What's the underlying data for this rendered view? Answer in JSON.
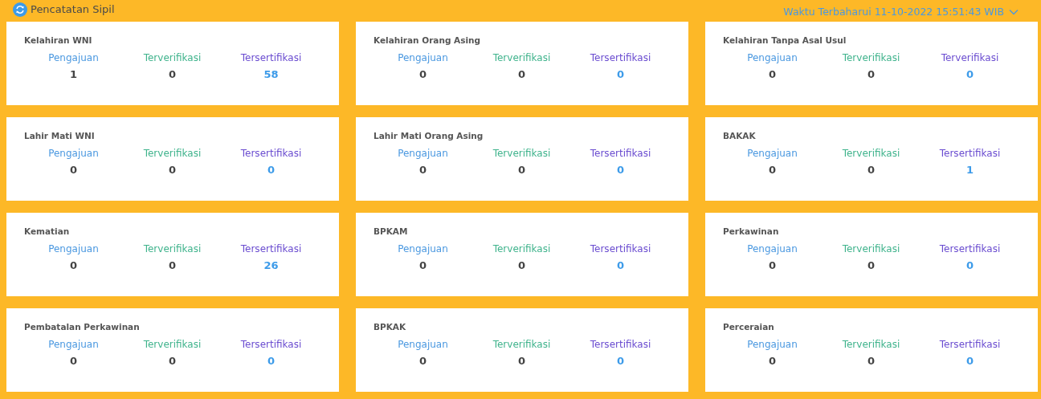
{
  "header": {
    "title": "Pencatatan Sipil",
    "updated": "Waktu Terbaharui 11-10-2022 15:51:43 WIB"
  },
  "cards": [
    {
      "title": "Kelahiran WNI",
      "stats": [
        {
          "kind": "submitted",
          "label": "Pengajuan",
          "value": "1"
        },
        {
          "kind": "verified",
          "label": "Terverifikasi",
          "value": "0"
        },
        {
          "kind": "certified",
          "label": "Tersertifikasi",
          "value": "58"
        }
      ]
    },
    {
      "title": "Kelahiran Orang Asing",
      "stats": [
        {
          "kind": "submitted",
          "label": "Pengajuan",
          "value": "0"
        },
        {
          "kind": "verified",
          "label": "Terverifikasi",
          "value": "0"
        },
        {
          "kind": "certified",
          "label": "Tersertifikasi",
          "value": "0"
        }
      ]
    },
    {
      "title": "Kelahiran Tanpa Asal Usul",
      "stats": [
        {
          "kind": "submitted",
          "label": "Pengajuan",
          "value": "0"
        },
        {
          "kind": "verified",
          "label": "Terverifikasi",
          "value": "0"
        },
        {
          "kind": "certified",
          "label": "Terverifikasi",
          "value": "0"
        }
      ]
    },
    {
      "title": "Lahir Mati WNI",
      "stats": [
        {
          "kind": "submitted",
          "label": "Pengajuan",
          "value": "0"
        },
        {
          "kind": "verified",
          "label": "Terverifikasi",
          "value": "0"
        },
        {
          "kind": "certified",
          "label": "Tersertifikasi",
          "value": "0"
        }
      ]
    },
    {
      "title": "Lahir Mati Orang Asing",
      "stats": [
        {
          "kind": "submitted",
          "label": "Pengajuan",
          "value": "0"
        },
        {
          "kind": "verified",
          "label": "Terverifikasi",
          "value": "0"
        },
        {
          "kind": "certified",
          "label": "Tersertifikasi",
          "value": "0"
        }
      ]
    },
    {
      "title": "BAKAK",
      "stats": [
        {
          "kind": "submitted",
          "label": "Pengajuan",
          "value": "0"
        },
        {
          "kind": "verified",
          "label": "Terverifikasi",
          "value": "0"
        },
        {
          "kind": "certified",
          "label": "Tersertifikasi",
          "value": "1"
        }
      ]
    },
    {
      "title": "Kematian",
      "stats": [
        {
          "kind": "submitted",
          "label": "Pengajuan",
          "value": "0"
        },
        {
          "kind": "verified",
          "label": "Terverifikasi",
          "value": "0"
        },
        {
          "kind": "certified",
          "label": "Tersertifikasi",
          "value": "26"
        }
      ]
    },
    {
      "title": "BPKAM",
      "stats": [
        {
          "kind": "submitted",
          "label": "Pengajuan",
          "value": "0"
        },
        {
          "kind": "verified",
          "label": "Terverifikasi",
          "value": "0"
        },
        {
          "kind": "certified",
          "label": "Tersertifikasi",
          "value": "0"
        }
      ]
    },
    {
      "title": "Perkawinan",
      "stats": [
        {
          "kind": "submitted",
          "label": "Pengajuan",
          "value": "0"
        },
        {
          "kind": "verified",
          "label": "Terverifikasi",
          "value": "0"
        },
        {
          "kind": "certified",
          "label": "Tersertifikasi",
          "value": "0"
        }
      ]
    },
    {
      "title": "Pembatalan Perkawinan",
      "stats": [
        {
          "kind": "submitted",
          "label": "Pengajuan",
          "value": "0"
        },
        {
          "kind": "verified",
          "label": "Terverifikasi",
          "value": "0"
        },
        {
          "kind": "certified",
          "label": "Tersertifikasi",
          "value": "0"
        }
      ]
    },
    {
      "title": "BPKAK",
      "stats": [
        {
          "kind": "submitted",
          "label": "Pengajuan",
          "value": "0"
        },
        {
          "kind": "verified",
          "label": "Terverifikasi",
          "value": "0"
        },
        {
          "kind": "certified",
          "label": "Tersertifikasi",
          "value": "0"
        }
      ]
    },
    {
      "title": "Perceraian",
      "stats": [
        {
          "kind": "submitted",
          "label": "Pengajuan",
          "value": "0"
        },
        {
          "kind": "verified",
          "label": "Terverifikasi",
          "value": "0"
        },
        {
          "kind": "certified",
          "label": "Tersertifikasi",
          "value": "0"
        }
      ]
    }
  ]
}
